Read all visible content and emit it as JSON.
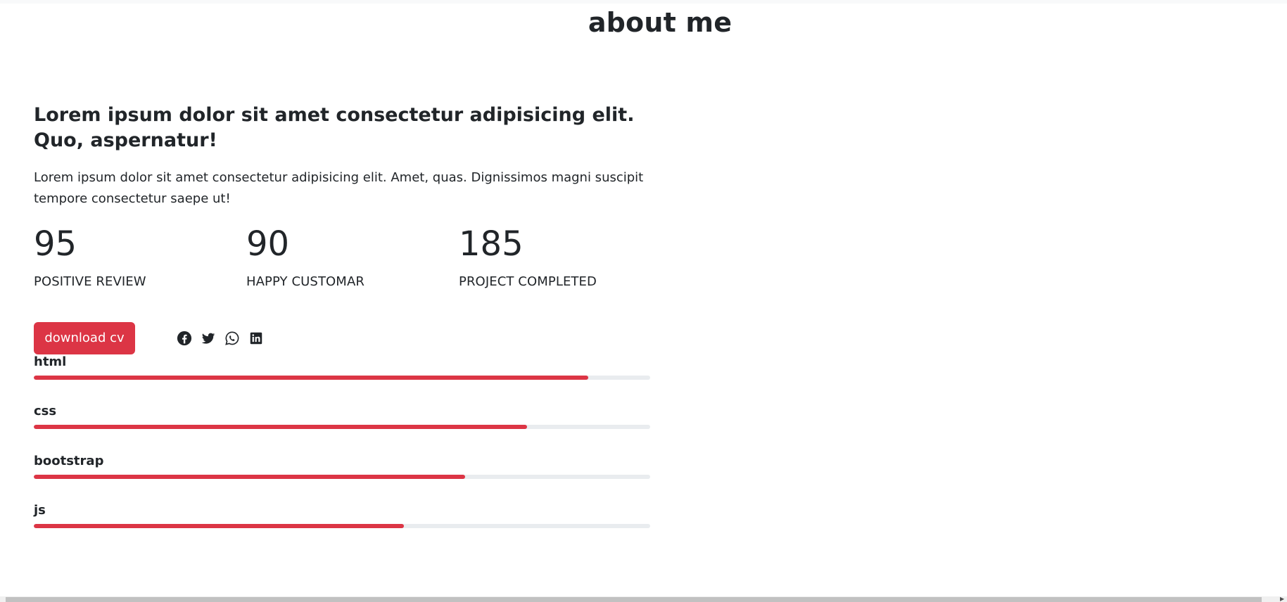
{
  "page": {
    "title": "about me"
  },
  "about": {
    "headline": "Lorem ipsum dolor sit amet consectetur adipisicing elit. Quo, aspernatur!",
    "intro": "Lorem ipsum dolor sit amet consectetur adipisicing elit. Amet, quas. Dignissimos magni suscipit tempore consectetur saepe ut!",
    "stats": [
      {
        "value": "95",
        "label": "POSITIVE REVIEW"
      },
      {
        "value": "90",
        "label": "HAPPY CUSTOMAR"
      },
      {
        "value": "185",
        "label": "PROJECT COMPLETED"
      }
    ],
    "download_label": "download cv",
    "social": [
      {
        "icon": "facebook-icon"
      },
      {
        "icon": "twitter-icon"
      },
      {
        "icon": "whatsapp-icon"
      },
      {
        "icon": "linkedin-icon"
      }
    ],
    "skills": [
      {
        "name": "html",
        "percent": 90
      },
      {
        "name": "css",
        "percent": 80
      },
      {
        "name": "bootstrap",
        "percent": 70
      },
      {
        "name": "js",
        "percent": 60
      }
    ]
  },
  "colors": {
    "accent": "#dc3545",
    "track": "#e9ecef",
    "text": "#212529"
  }
}
